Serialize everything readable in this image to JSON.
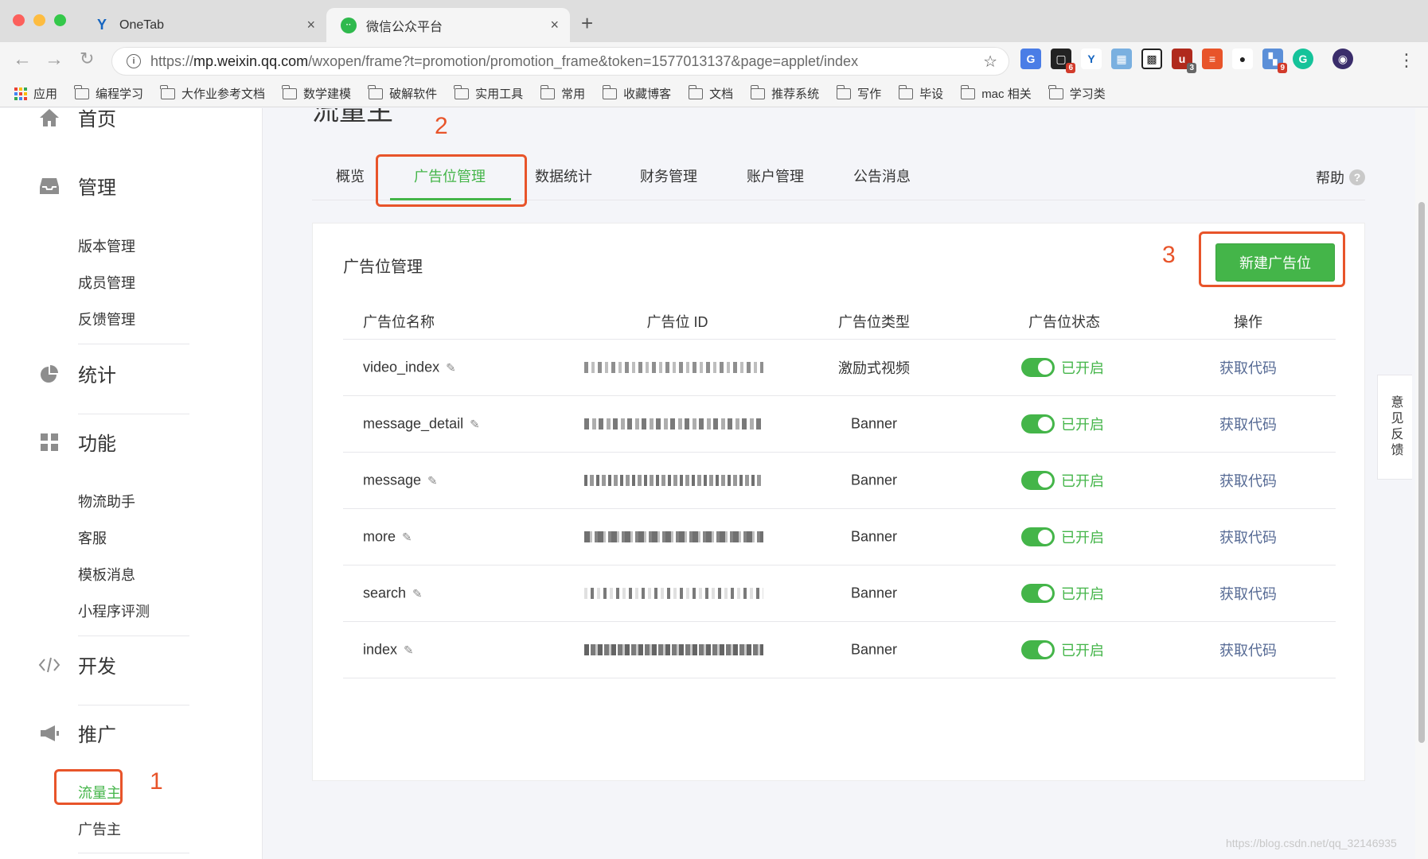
{
  "browser": {
    "tabs": [
      {
        "title": "OneTab"
      },
      {
        "title": "微信公众平台"
      }
    ],
    "url_prefix": "https://",
    "url_host": "mp.weixin.qq.com",
    "url_path": "/wxopen/frame?t=promotion/promotion_frame&token=1577013137&page=applet/index",
    "extension_badges": [
      "6",
      "3",
      "9"
    ],
    "bookmarks": [
      "应用",
      "编程学习",
      "大作业参考文档",
      "数学建模",
      "破解软件",
      "实用工具",
      "常用",
      "收藏博客",
      "文档",
      "推荐系统",
      "写作",
      "毕设",
      "mac 相关",
      "学习类"
    ]
  },
  "sidebar": {
    "home": "首页",
    "manage": "管理",
    "manage_items": [
      "版本管理",
      "成员管理",
      "反馈管理"
    ],
    "stats": "统计",
    "features": "功能",
    "feature_items": [
      "物流助手",
      "客服",
      "模板消息",
      "小程序评测"
    ],
    "dev": "开发",
    "promotion": "推广",
    "promotion_items": [
      "流量主",
      "广告主"
    ]
  },
  "main": {
    "page_title": "流量主",
    "tabs": [
      "概览",
      "广告位管理",
      "数据统计",
      "财务管理",
      "账户管理",
      "公告消息"
    ],
    "active_tab": "广告位管理",
    "help": "帮助",
    "card_title": "广告位管理",
    "new_button": "新建广告位",
    "columns": [
      "广告位名称",
      "广告位 ID",
      "广告位类型",
      "广告位状态",
      "操作"
    ],
    "rows": [
      {
        "name": "video_index",
        "type": "激励式视频",
        "status": "已开启",
        "action": "获取代码"
      },
      {
        "name": "message_detail",
        "type": "Banner",
        "status": "已开启",
        "action": "获取代码"
      },
      {
        "name": "message",
        "type": "Banner",
        "status": "已开启",
        "action": "获取代码"
      },
      {
        "name": "more",
        "type": "Banner",
        "status": "已开启",
        "action": "获取代码"
      },
      {
        "name": "search",
        "type": "Banner",
        "status": "已开启",
        "action": "获取代码"
      },
      {
        "name": "index",
        "type": "Banner",
        "status": "已开启",
        "action": "获取代码"
      }
    ]
  },
  "feedback": "意见反馈",
  "annotations": [
    "1",
    "2",
    "3"
  ],
  "watermark": "https://blog.csdn.net/qq_32146935",
  "colors": {
    "accent": "#44b549",
    "link": "#576b95",
    "annotation": "#e8542a"
  }
}
